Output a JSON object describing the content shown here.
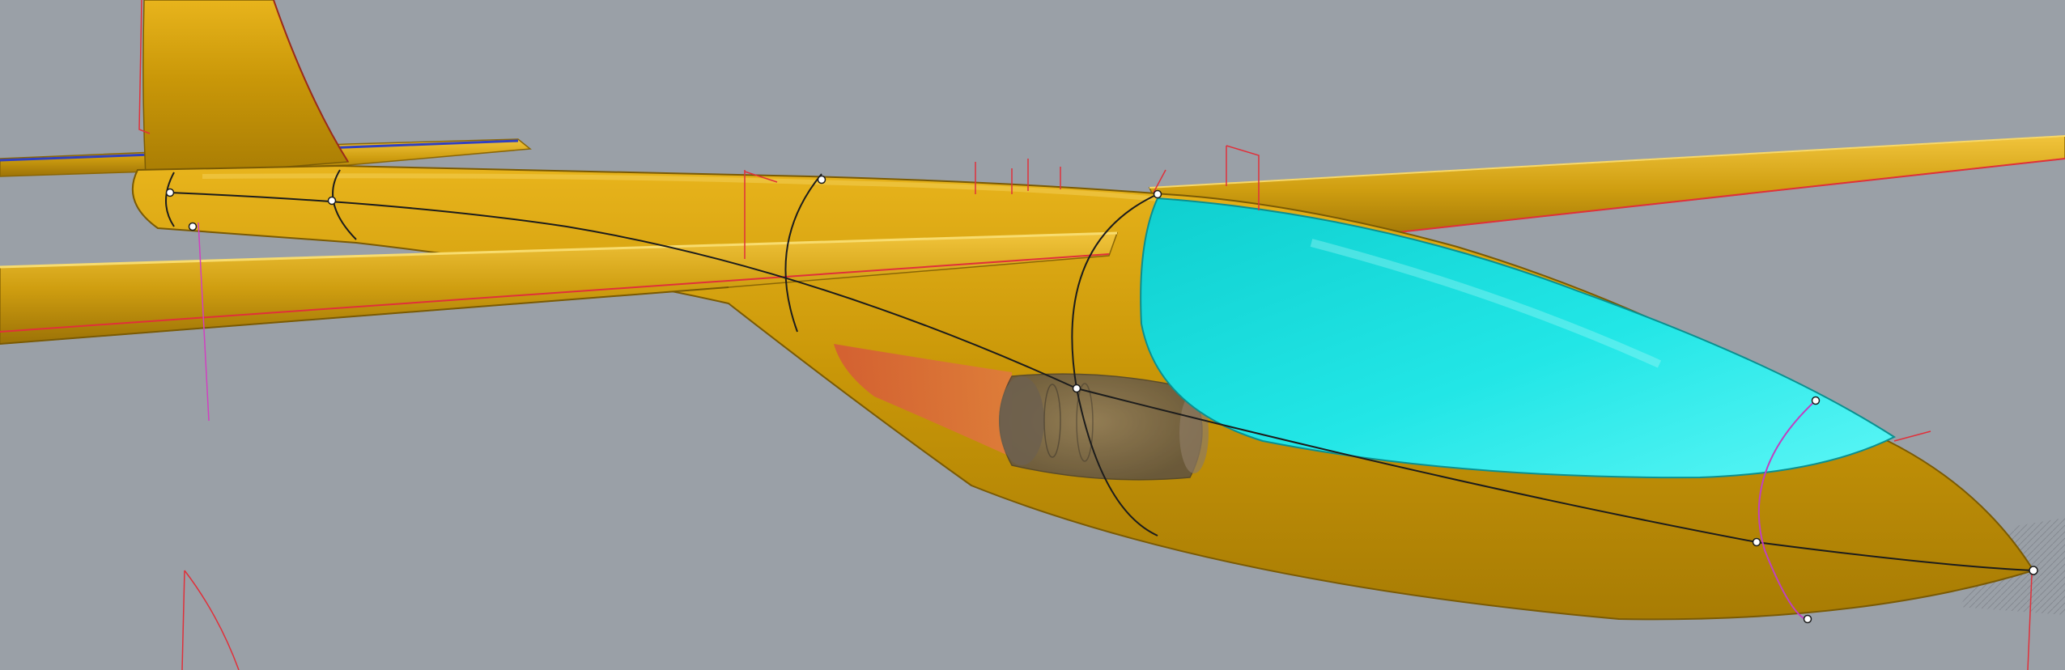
{
  "scene": {
    "subject": "glider",
    "background_color": "#9aa0a7",
    "colors": {
      "body": "#d2a10f",
      "body_dark": "#9e7606",
      "body_light": "#f0c238",
      "canopy": "#1bd8d8",
      "canopy_light": "#5ff7f7",
      "engine_bay": "#d96b3b",
      "engine": "#7a6b5a",
      "edge_red": "#e0303a",
      "edge_blue": "#3040c0",
      "edge_magenta": "#d040c0",
      "wire_black": "#1c1c1c",
      "grip_white": "#ffffff"
    }
  }
}
